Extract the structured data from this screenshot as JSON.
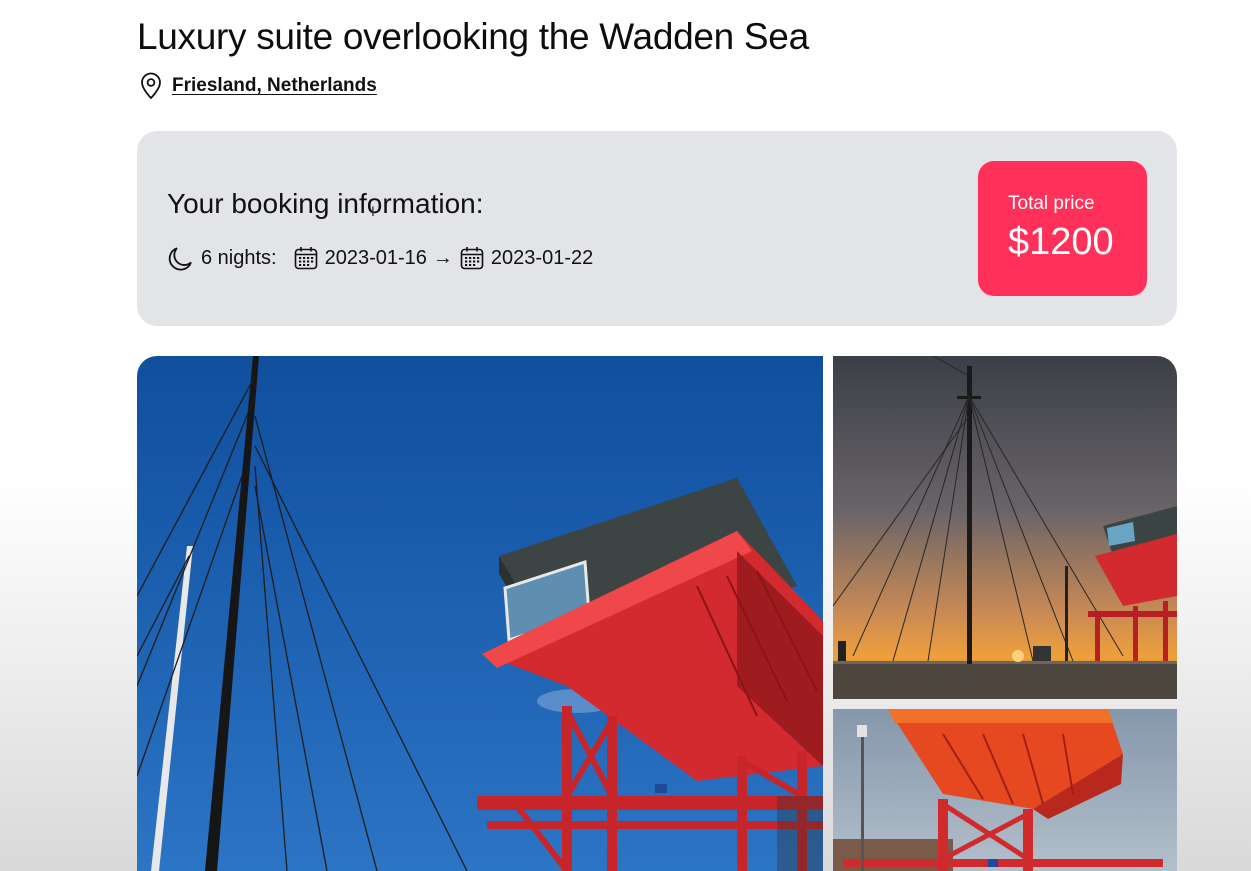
{
  "listing": {
    "title": "Luxury suite overlooking the Wadden Sea",
    "location": "Friesland, Netherlands",
    "location_icon": "map-pin-icon"
  },
  "booking": {
    "heading": "Your booking information:",
    "nights_label": "6 nights:",
    "check_in": "2023-01-16",
    "arrow": "→",
    "check_out": "2023-01-22",
    "icons": [
      "moon-icon",
      "calendar-icon",
      "calendar-icon"
    ]
  },
  "price": {
    "label": "Total price",
    "value": "$1200",
    "accent_color": "#ff3059"
  },
  "gallery": {
    "images": [
      "red-cabin-and-ship-masts-under-blue-sky",
      "ship-mast-rigging-at-sunset",
      "red-elevated-cabin-structure"
    ]
  },
  "colors": {
    "card_background": "#e3e4e7",
    "text": "#111111",
    "sky_blue": "#1a5aa6",
    "structure_red": "#d92b2e"
  }
}
